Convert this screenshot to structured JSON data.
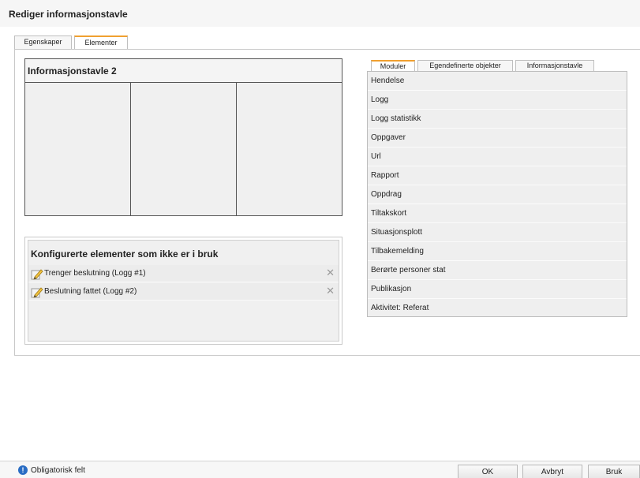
{
  "window": {
    "title": "Rediger informasjonstavle"
  },
  "tabs": [
    {
      "label": "Egenskaper",
      "active": false
    },
    {
      "label": "Elementer",
      "active": true
    }
  ],
  "board": {
    "title": "Informasjonstavle 2",
    "columns": 3
  },
  "unused": {
    "title": "Konfigurerte elementer som ikke er i bruk",
    "items": [
      {
        "label": "Trenger beslutning (Logg #1)",
        "icon": "pencil-icon"
      },
      {
        "label": "Beslutning fattet (Logg #2)",
        "icon": "pencil-icon"
      }
    ]
  },
  "right_tabs": [
    {
      "label": "Moduler",
      "active": true
    },
    {
      "label": "Egendefinerte objekter",
      "active": false
    },
    {
      "label": "Informasjonstavle",
      "active": false
    }
  ],
  "modules": [
    "Hendelse",
    "Logg",
    "Logg statistikk",
    "Oppgaver",
    "Url",
    "Rapport",
    "Oppdrag",
    "Tiltakskort",
    "Situasjonsplott",
    "Tilbakemelding",
    "Berørte personer stat",
    "Publikasjon",
    "Aktivitet: Referat"
  ],
  "footer": {
    "required_label": "Obligatorisk felt",
    "info_icon": "info-icon",
    "buttons": {
      "ok": "OK",
      "cancel": "Avbryt",
      "apply": "Bruk"
    }
  },
  "colors": {
    "accent": "#f0a030",
    "info": "#2a6dc4"
  }
}
